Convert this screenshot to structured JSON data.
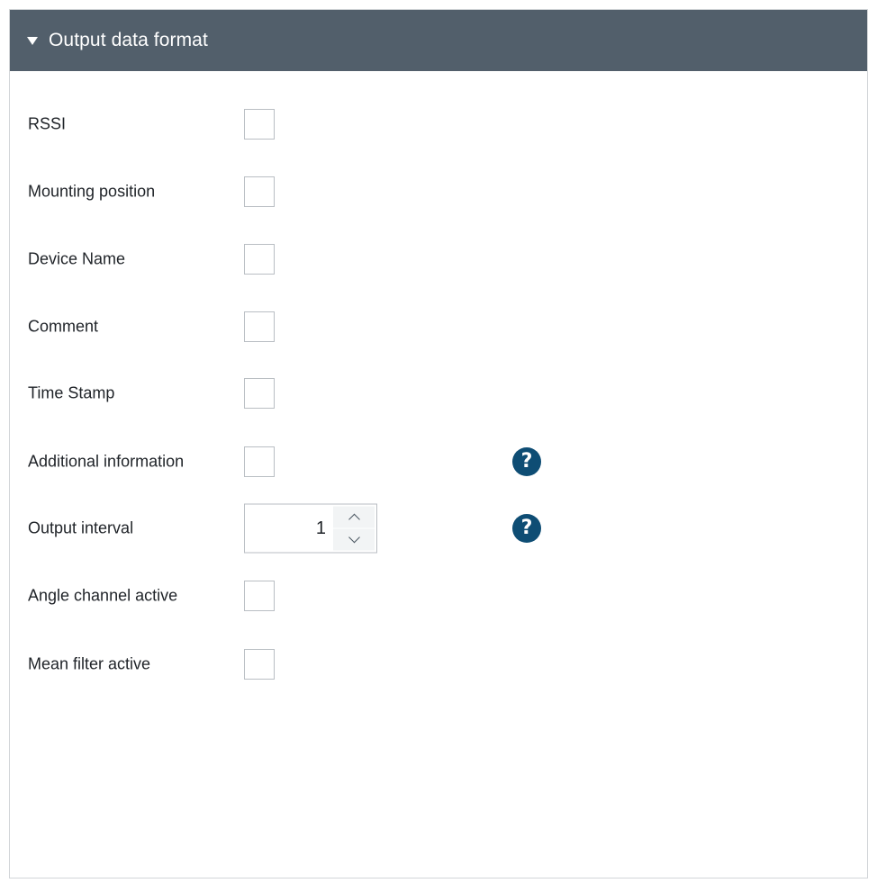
{
  "panel": {
    "title": "Output data format",
    "expanded": true,
    "header_color": "#525f6b"
  },
  "fields": {
    "rssi": {
      "label": "RSSI",
      "checked": false
    },
    "mounting_position": {
      "label": "Mounting position",
      "checked": false
    },
    "device_name": {
      "label": "Device Name",
      "checked": false
    },
    "comment": {
      "label": "Comment",
      "checked": false
    },
    "time_stamp": {
      "label": "Time Stamp",
      "checked": false
    },
    "additional_information": {
      "label": "Additional information",
      "checked": false,
      "help_icon": "help-circle-icon"
    },
    "output_interval": {
      "label": "Output interval",
      "value": "1",
      "help_icon": "help-circle-icon"
    },
    "angle_channel_active": {
      "label": "Angle channel active",
      "checked": false
    },
    "mean_filter_active": {
      "label": "Mean filter active",
      "checked": false
    }
  },
  "colors": {
    "help_icon": "#0e4d74",
    "border": "#b9bec3"
  }
}
